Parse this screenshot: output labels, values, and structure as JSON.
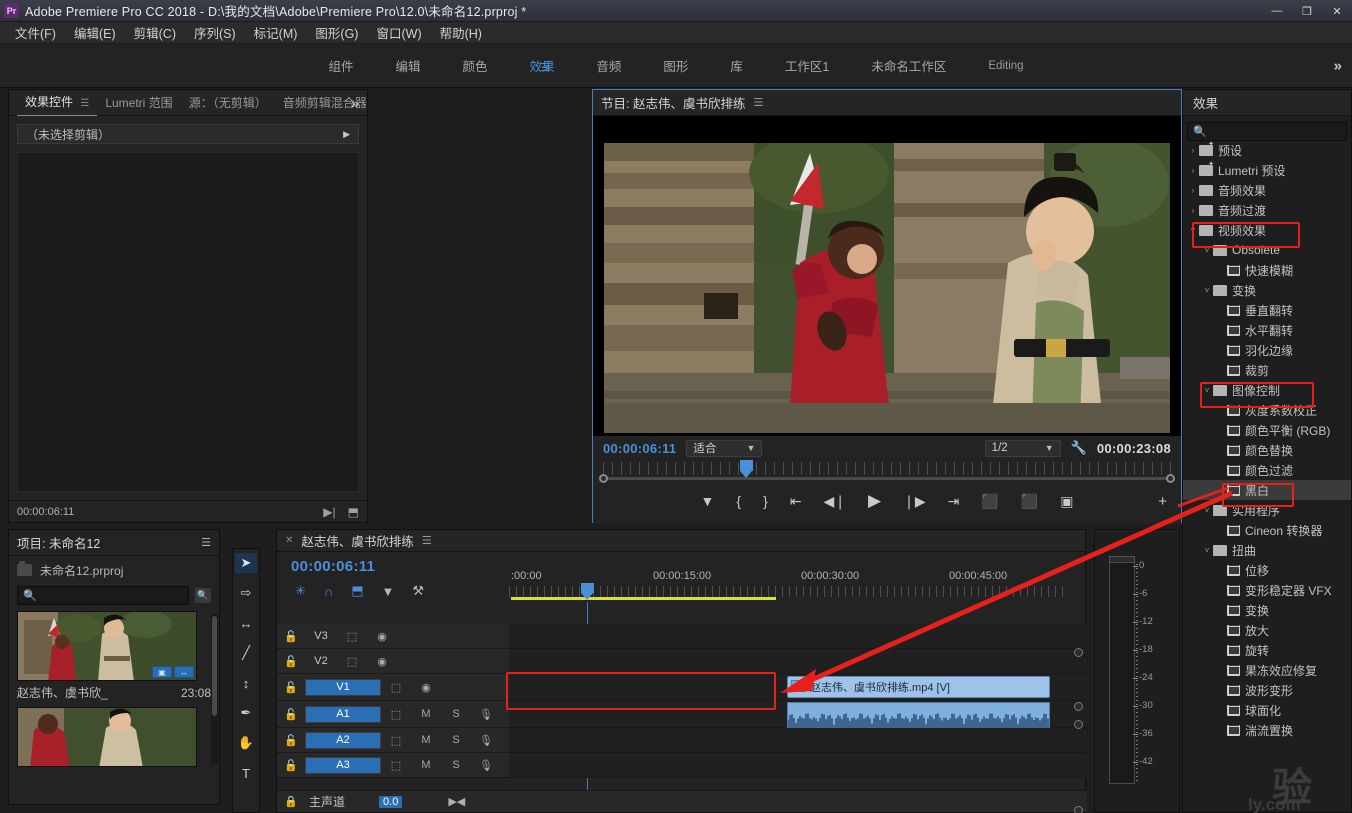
{
  "window": {
    "app_icon": "Pr",
    "title": "Adobe Premiere Pro CC 2018 - D:\\我的文档\\Adobe\\Premiere Pro\\12.0\\未命名12.prproj *",
    "minimize": "—",
    "maximize": "❐",
    "close": "✕"
  },
  "menu": {
    "items": [
      "文件(F)",
      "编辑(E)",
      "剪辑(C)",
      "序列(S)",
      "标记(M)",
      "图形(G)",
      "窗口(W)",
      "帮助(H)"
    ]
  },
  "workspace": {
    "items": [
      {
        "label": "组件",
        "active": false
      },
      {
        "label": "编辑",
        "active": false
      },
      {
        "label": "颜色",
        "active": false
      },
      {
        "label": "效果",
        "active": true
      },
      {
        "label": "音频",
        "active": false
      },
      {
        "label": "图形",
        "active": false
      },
      {
        "label": "库",
        "active": false
      },
      {
        "label": "工作区1",
        "active": false
      },
      {
        "label": "未命名工作区",
        "active": false
      },
      {
        "label": "Editing",
        "active": false
      }
    ],
    "overflow": "»"
  },
  "effect_controls": {
    "tabs": [
      {
        "label": "效果控件",
        "active": true
      },
      {
        "label": "Lumetri 范围",
        "active": false
      },
      {
        "label": "源：（无剪辑）",
        "active": false
      },
      {
        "label": "音频剪辑混合器: 赵志伟、虞书欣排...",
        "active": false
      }
    ],
    "overflow": "»",
    "no_clip_text": "（未选择剪辑）",
    "footer_timecode": "00:00:06:11"
  },
  "project": {
    "title": "项目: 未命名12",
    "file_name": "未命名12.prproj",
    "search_placeholder": "",
    "search_value": "",
    "items": [
      {
        "name": "赵志伟、虞书欣_",
        "duration": "23:08"
      },
      {
        "name": "",
        "duration": ""
      }
    ]
  },
  "program_monitor": {
    "title": "节目: 赵志伟、虞书欣排练",
    "playhead_timecode": "00:00:06:11",
    "fit_label": "适合",
    "resolution_label": "1/2",
    "duration_timecode": "00:00:23:08",
    "transport": [
      {
        "name": "add-marker-button",
        "glyph": "▼"
      },
      {
        "name": "mark-in-button",
        "glyph": "{"
      },
      {
        "name": "mark-out-button",
        "glyph": "}"
      },
      {
        "name": "go-to-in-button",
        "glyph": "⇤"
      },
      {
        "name": "step-back-button",
        "glyph": "◀❘"
      },
      {
        "name": "play-button",
        "glyph": "▶"
      },
      {
        "name": "step-forward-button",
        "glyph": "❘▶"
      },
      {
        "name": "go-to-out-button",
        "glyph": "⇥"
      },
      {
        "name": "lift-button",
        "glyph": "⬛"
      },
      {
        "name": "extract-button",
        "glyph": "⬛"
      },
      {
        "name": "export-frame-button",
        "glyph": "▣"
      }
    ],
    "plus_button": "+"
  },
  "timeline": {
    "tab_label": "赵志伟、虞书欣排练",
    "close_glyph": "✕",
    "playhead_timecode": "00:00:06:11",
    "tools": [
      {
        "name": "nest-toggle",
        "glyph": "✳",
        "active": true
      },
      {
        "name": "snap-toggle",
        "glyph": "∩",
        "active": true
      },
      {
        "name": "linked-selection-toggle",
        "glyph": "⬒",
        "active": true
      },
      {
        "name": "add-marker-button",
        "glyph": "▼",
        "active": false
      },
      {
        "name": "timeline-settings-button",
        "glyph": "⚒",
        "active": false
      }
    ],
    "ruler_labels": [
      ":00:00",
      "00:00:15:00",
      "00:00:30:00",
      "00:00:45:00"
    ],
    "tracks": [
      {
        "name": "V3",
        "type": "video",
        "selected": false
      },
      {
        "name": "V2",
        "type": "video",
        "selected": false
      },
      {
        "name": "V1",
        "type": "video",
        "selected": true
      },
      {
        "name": "A1",
        "type": "audio",
        "selected": true
      },
      {
        "name": "A2",
        "type": "audio",
        "selected": true
      },
      {
        "name": "A3",
        "type": "audio",
        "selected": true
      }
    ],
    "track_icons": {
      "lock": "🔒",
      "sync": "⬚",
      "eye": "◉",
      "mute": "M",
      "solo": "S",
      "mic": "🎙"
    },
    "clip": {
      "label": "赵志伟、虞书欣排练.mp4 [V]",
      "fx_badge": "fx"
    },
    "master_track": {
      "label": "主声道",
      "value": "0.0"
    }
  },
  "tools_palette": [
    {
      "name": "selection-tool",
      "glyph": "➤",
      "active": true
    },
    {
      "name": "track-select-forward-tool",
      "glyph": "⇨",
      "active": false
    },
    {
      "name": "ripple-edit-tool",
      "glyph": "↔",
      "active": false
    },
    {
      "name": "razor-tool",
      "glyph": "╱",
      "active": false
    },
    {
      "name": "slip-tool",
      "glyph": "↕",
      "active": false
    },
    {
      "name": "pen-tool",
      "glyph": "✒",
      "active": false
    },
    {
      "name": "hand-tool",
      "glyph": "✋",
      "active": false
    },
    {
      "name": "type-tool",
      "glyph": "T",
      "active": false
    }
  ],
  "audio_meters": {
    "scale": [
      "0",
      "-6",
      "-12",
      "-18",
      "-24",
      "-30",
      "-36",
      "-42"
    ]
  },
  "effects_panel": {
    "tab_label": "效果",
    "search_value": "",
    "search_placeholder": "",
    "tree": [
      {
        "label": "预设",
        "kind": "folder-star",
        "depth": 0,
        "arrow": "›",
        "highlight": false,
        "selected": false
      },
      {
        "label": "Lumetri 预设",
        "kind": "folder-star",
        "depth": 0,
        "arrow": "›",
        "highlight": false,
        "selected": false
      },
      {
        "label": "音频效果",
        "kind": "folder",
        "depth": 0,
        "arrow": "›",
        "highlight": false,
        "selected": false
      },
      {
        "label": "音频过渡",
        "kind": "folder",
        "depth": 0,
        "arrow": "›",
        "highlight": false,
        "selected": false
      },
      {
        "label": "视频效果",
        "kind": "folder",
        "depth": 0,
        "arrow": "˅",
        "highlight": true,
        "selected": false
      },
      {
        "label": "Obsolete",
        "kind": "folder",
        "depth": 1,
        "arrow": "˅",
        "highlight": false,
        "selected": false
      },
      {
        "label": "快速模糊",
        "kind": "effect",
        "depth": 2,
        "arrow": "",
        "highlight": false,
        "selected": false
      },
      {
        "label": "变换",
        "kind": "folder",
        "depth": 1,
        "arrow": "˅",
        "highlight": false,
        "selected": false
      },
      {
        "label": "垂直翻转",
        "kind": "effect",
        "depth": 2,
        "arrow": "",
        "highlight": false,
        "selected": false
      },
      {
        "label": "水平翻转",
        "kind": "effect",
        "depth": 2,
        "arrow": "",
        "highlight": false,
        "selected": false
      },
      {
        "label": "羽化边缘",
        "kind": "effect",
        "depth": 2,
        "arrow": "",
        "highlight": false,
        "selected": false
      },
      {
        "label": "裁剪",
        "kind": "effect",
        "depth": 2,
        "arrow": "",
        "highlight": false,
        "selected": false
      },
      {
        "label": "图像控制",
        "kind": "folder",
        "depth": 1,
        "arrow": "˅",
        "highlight": true,
        "selected": false
      },
      {
        "label": "灰度系数校正",
        "kind": "effect",
        "depth": 2,
        "arrow": "",
        "highlight": false,
        "selected": false
      },
      {
        "label": "颜色平衡 (RGB)",
        "kind": "effect",
        "depth": 2,
        "arrow": "",
        "highlight": false,
        "selected": false
      },
      {
        "label": "颜色替换",
        "kind": "effect",
        "depth": 2,
        "arrow": "",
        "highlight": false,
        "selected": false
      },
      {
        "label": "颜色过滤",
        "kind": "effect",
        "depth": 2,
        "arrow": "",
        "highlight": false,
        "selected": false
      },
      {
        "label": "黑白",
        "kind": "effect",
        "depth": 2,
        "arrow": "",
        "highlight": true,
        "selected": true
      },
      {
        "label": "实用程序",
        "kind": "folder",
        "depth": 1,
        "arrow": "˅",
        "highlight": false,
        "selected": false
      },
      {
        "label": "Cineon 转换器",
        "kind": "effect",
        "depth": 2,
        "arrow": "",
        "highlight": false,
        "selected": false
      },
      {
        "label": "扭曲",
        "kind": "folder",
        "depth": 1,
        "arrow": "˅",
        "highlight": false,
        "selected": false
      },
      {
        "label": "位移",
        "kind": "effect",
        "depth": 2,
        "arrow": "",
        "highlight": false,
        "selected": false
      },
      {
        "label": "变形稳定器 VFX",
        "kind": "effect",
        "depth": 2,
        "arrow": "",
        "highlight": false,
        "selected": false
      },
      {
        "label": "变换",
        "kind": "effect",
        "depth": 2,
        "arrow": "",
        "highlight": false,
        "selected": false
      },
      {
        "label": "放大",
        "kind": "effect",
        "depth": 2,
        "arrow": "",
        "highlight": false,
        "selected": false
      },
      {
        "label": "旋转",
        "kind": "effect",
        "depth": 2,
        "arrow": "",
        "highlight": false,
        "selected": false
      },
      {
        "label": "果冻效应修复",
        "kind": "effect",
        "depth": 2,
        "arrow": "",
        "highlight": false,
        "selected": false
      },
      {
        "label": "波形变形",
        "kind": "effect",
        "depth": 2,
        "arrow": "",
        "highlight": false,
        "selected": false
      },
      {
        "label": "球面化",
        "kind": "effect",
        "depth": 2,
        "arrow": "",
        "highlight": false,
        "selected": false
      },
      {
        "label": "湍流置换",
        "kind": "effect",
        "depth": 2,
        "arrow": "",
        "highlight": false,
        "selected": false
      }
    ]
  },
  "annotations": {
    "accent_red": "#e8201c",
    "accent_blue": "#4a90d9"
  }
}
